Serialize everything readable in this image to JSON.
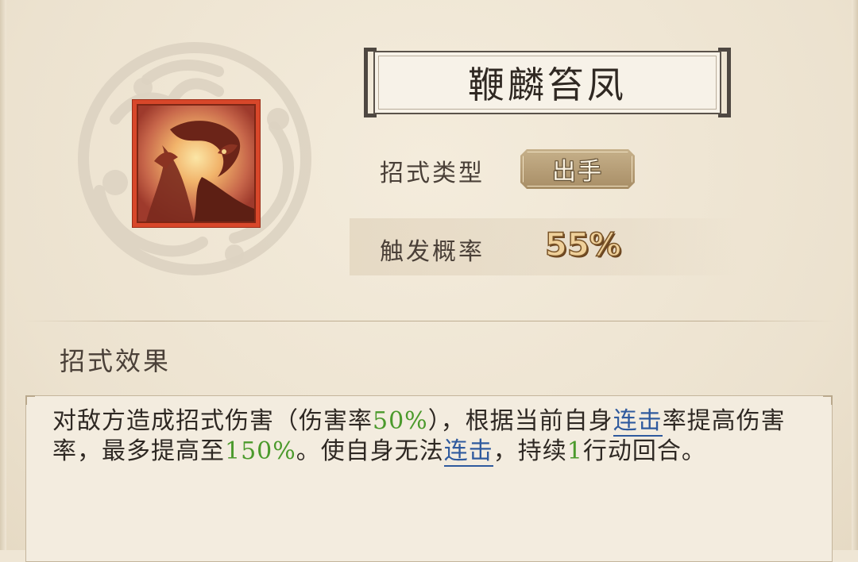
{
  "skill": {
    "name": "鞭麟笞凤",
    "icon": "dragon-phoenix-icon"
  },
  "info": {
    "type_label": "招式类型",
    "type_value": "出手",
    "rate_label": "触发概率",
    "rate_value": "55%"
  },
  "effect": {
    "section_title": "招式效果",
    "segments": [
      {
        "t": "对敌方造成招式伤害（伤害率",
        "s": "plain"
      },
      {
        "t": "50%",
        "s": "green"
      },
      {
        "t": "），根据当前自身",
        "s": "plain"
      },
      {
        "t": "连击",
        "s": "link"
      },
      {
        "t": "率提高伤害率，最多提高至",
        "s": "plain"
      },
      {
        "t": "150%",
        "s": "green"
      },
      {
        "t": "。使自身无法",
        "s": "plain"
      },
      {
        "t": "连击",
        "s": "link"
      },
      {
        "t": "，持续",
        "s": "plain"
      },
      {
        "t": "1",
        "s": "green"
      },
      {
        "t": "行动回合。",
        "s": "plain"
      }
    ]
  },
  "colors": {
    "highlight_green": "#4b9a2c",
    "keyword_blue": "#2f5a9e",
    "icon_frame": "#d8472a"
  }
}
